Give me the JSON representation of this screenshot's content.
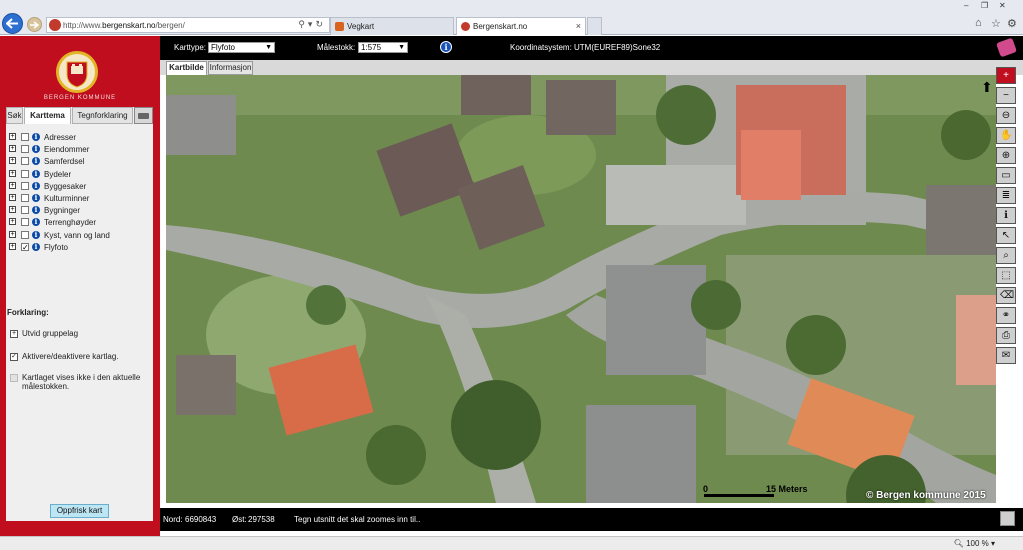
{
  "browser": {
    "url_prefix": "http://www.",
    "url_host": "bergenskart.no",
    "url_path": "/bergen/",
    "tabs": [
      {
        "label": "Vegkart",
        "active": false
      },
      {
        "label": "Bergenskart.no",
        "active": true
      }
    ],
    "close_symbol": "×",
    "window_controls": [
      "–",
      "❐",
      "✕"
    ],
    "right_icons": [
      "home-icon",
      "star-icon",
      "gear-icon"
    ]
  },
  "left_panel": {
    "logo_text": "BERGEN KOMMUNE",
    "tabs": [
      "Søk",
      "Karttema",
      "Tegnforklaring"
    ],
    "active_tab": "Karttema",
    "layers": [
      {
        "name": "Adresser",
        "checked": false
      },
      {
        "name": "Eiendommer",
        "checked": false
      },
      {
        "name": "Samferdsel",
        "checked": false
      },
      {
        "name": "Bydeler",
        "checked": false
      },
      {
        "name": "Byggesaker",
        "checked": false
      },
      {
        "name": "Kulturminner",
        "checked": false
      },
      {
        "name": "Bygninger",
        "checked": false
      },
      {
        "name": "Terrenghøyder",
        "checked": false
      },
      {
        "name": "Kyst, vann og land",
        "checked": false
      },
      {
        "name": "Flyfoto",
        "checked": true
      }
    ],
    "forklaring_title": "Forklaring:",
    "legend": [
      {
        "symbol": "+",
        "text": "Utvid gruppelag"
      },
      {
        "symbol": "✓",
        "text": "Aktivere/deaktivere kartlag."
      },
      {
        "symbol": "",
        "text": "Kartlaget vises ikke i den aktuelle målestokken."
      }
    ],
    "refresh_button": "Oppfrisk kart"
  },
  "topbar": {
    "karttype_label": "Karttype:",
    "karttype_value": "Flyfoto",
    "malestokk_label": "Målestokk:",
    "malestokk_value": "1:575",
    "koordinat_label": "Koordinatsystem:",
    "koordinat_value": "UTM(EUREF89)Sone32"
  },
  "map_tabs": [
    "Kartbilde",
    "Informasjon"
  ],
  "map": {
    "scale_zero": "0",
    "scale_end": "15 Meters",
    "copyright": "© Bergen kommune 2015"
  },
  "toolbar": [
    "zoom-in-icon",
    "zoom-out-icon",
    "zoom-previous-icon",
    "pan-hand-icon",
    "globe-icon",
    "full-extent-icon",
    "layers-icon",
    "info-icon",
    "select-icon",
    "zoom-select-icon",
    "area-select-icon",
    "eraser-icon",
    "binoculars-icon",
    "print-icon",
    "mail-icon"
  ],
  "bottombar": {
    "nord_label": "Nord:",
    "nord_value": "6690843",
    "ost_label": "Øst:",
    "ost_value": "297538",
    "hint": "Tegn utsnitt det skal zoomes inn til.."
  },
  "status": {
    "zoom": "100 %"
  }
}
